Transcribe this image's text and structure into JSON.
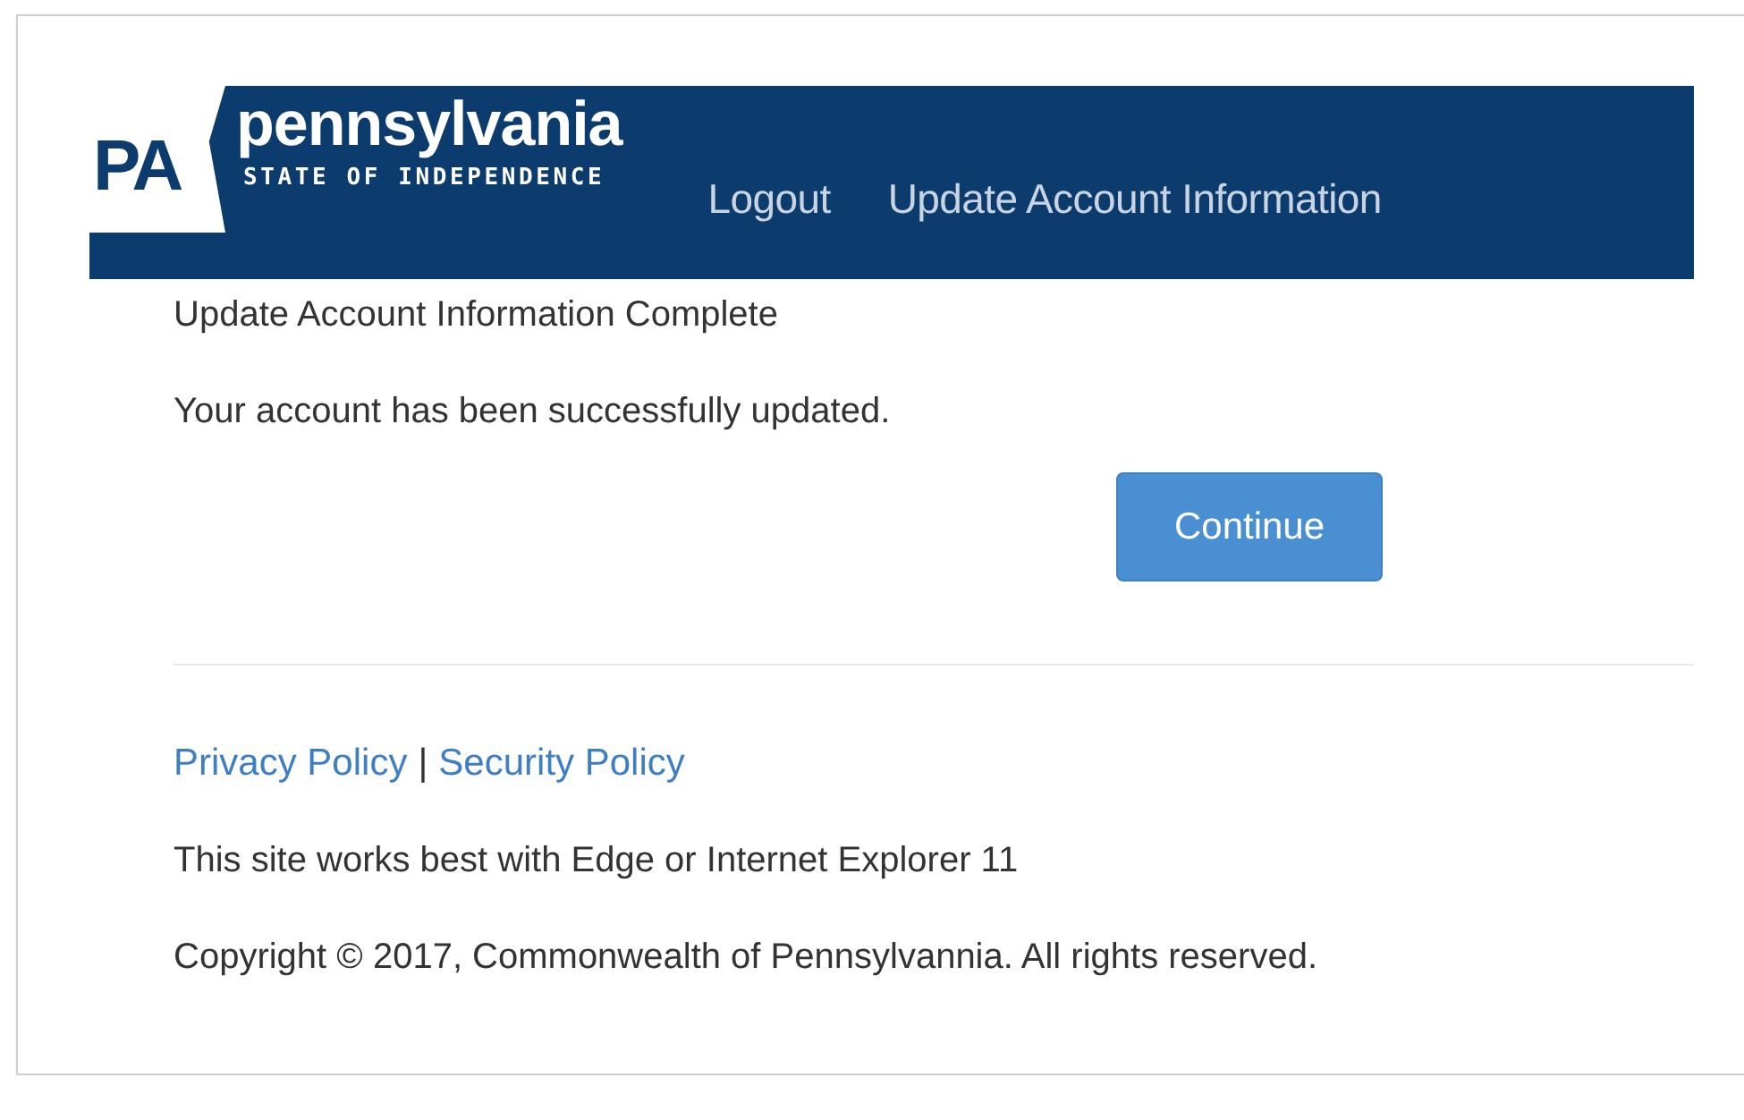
{
  "header": {
    "logo": {
      "badge": "PA",
      "name": "pennsylvania",
      "tagline": "STATE OF INDEPENDENCE"
    },
    "nav": [
      {
        "label": "Logout"
      },
      {
        "label": "Update Account Information"
      }
    ]
  },
  "main": {
    "title": "Update Account Information Complete",
    "message": "Your account has been successfully updated.",
    "button": "Continue"
  },
  "footer": {
    "links": [
      {
        "label": "Privacy Policy"
      },
      {
        "label": "Security Policy"
      }
    ],
    "separator": "|",
    "notice": "This site works best with Edge or Internet Explorer 11",
    "copyright": "Copyright © 2017, Commonwealth of Pennsylvannia. All rights reserved."
  }
}
